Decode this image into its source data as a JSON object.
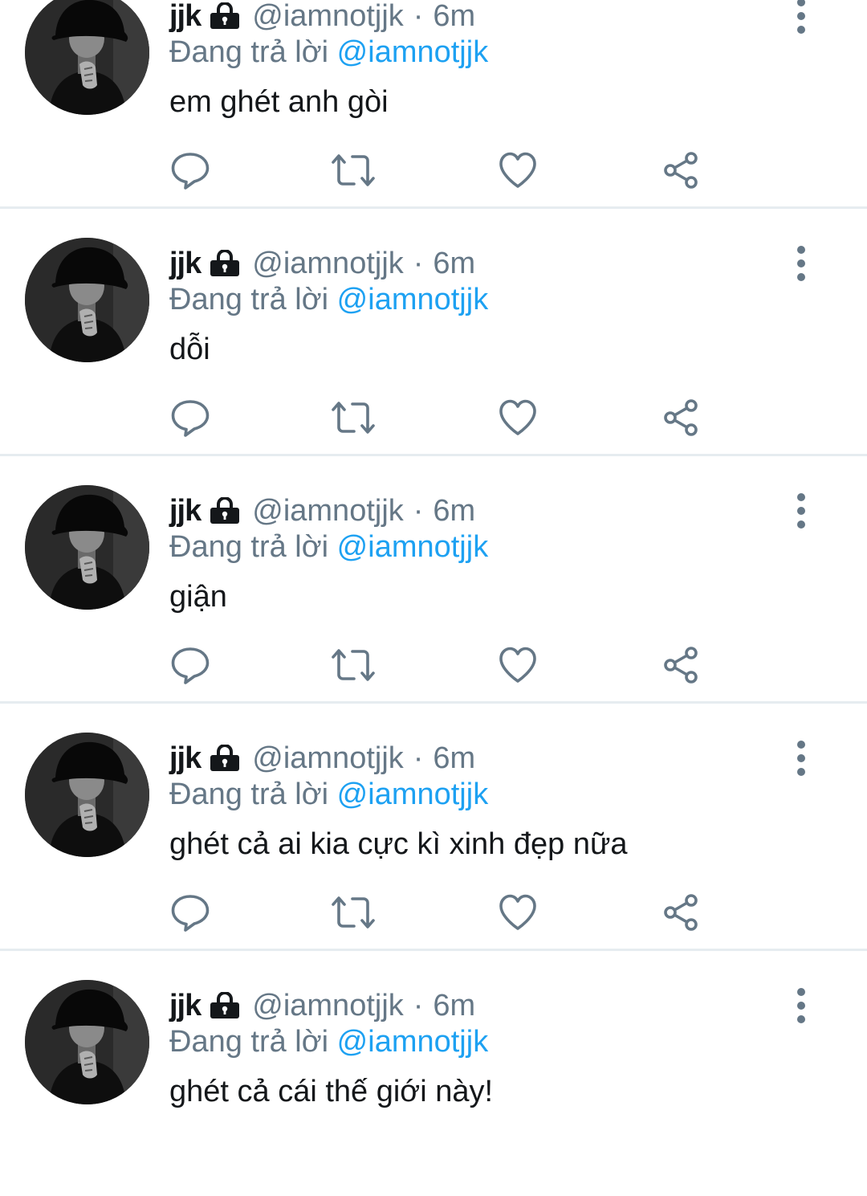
{
  "replying_prefix": "Đang trả lời",
  "icons": {
    "reply": "reply-icon",
    "retweet": "retweet-icon",
    "like": "heart-icon",
    "share": "share-icon",
    "more": "more-icon",
    "protected": "lock-icon"
  },
  "colors": {
    "text": "#14171a",
    "secondary": "#657786",
    "link": "#1da1f2",
    "divider": "#e6ecf0"
  },
  "tweets": [
    {
      "name": "jjk",
      "handle": "@iamnotjjk",
      "separator": "·",
      "time": "6m",
      "reply_to": "@iamnotjjk",
      "text": "em ghét anh gòi"
    },
    {
      "name": "jjk",
      "handle": "@iamnotjjk",
      "separator": "·",
      "time": "6m",
      "reply_to": "@iamnotjjk",
      "text": "dỗi"
    },
    {
      "name": "jjk",
      "handle": "@iamnotjjk",
      "separator": "·",
      "time": "6m",
      "reply_to": "@iamnotjjk",
      "text": "giận"
    },
    {
      "name": "jjk",
      "handle": "@iamnotjjk",
      "separator": "·",
      "time": "6m",
      "reply_to": "@iamnotjjk",
      "text": "ghét cả ai kia cực kì xinh đẹp nữa"
    },
    {
      "name": "jjk",
      "handle": "@iamnotjjk",
      "separator": "·",
      "time": "6m",
      "reply_to": "@iamnotjjk",
      "text": "ghét cả cái thế giới này!"
    }
  ]
}
